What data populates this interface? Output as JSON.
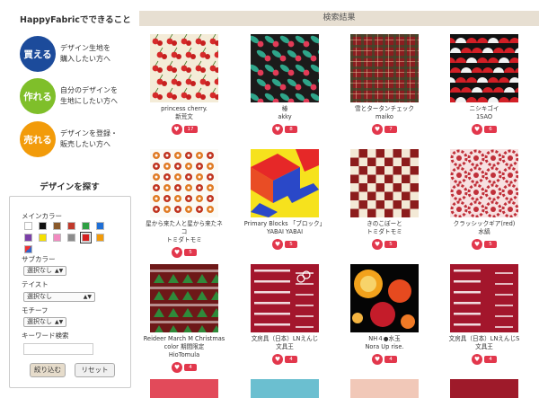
{
  "sidebar": {
    "title": "HappyFabricでできること",
    "roles": [
      {
        "label": "買える",
        "line1": "デザイン生地を",
        "line2": "購入したい方へ"
      },
      {
        "label": "作れる",
        "line1": "自分のデザインを",
        "line2": "生地にしたい方へ"
      },
      {
        "label": "売れる",
        "line1": "デザインを登録・",
        "line2": "販売したい方へ"
      }
    ],
    "find_title": "デザインを探す",
    "main_color_label": "メインカラー",
    "colors": [
      "#ffffff",
      "#111111",
      "#8a5a2b",
      "#c0392b",
      "#2ea043",
      "#1f6fd6",
      "#7b3fa8",
      "#f5e000",
      "#f28ac0",
      "#8c8c8c",
      "#d6201f",
      "#f29b0a",
      "#multi"
    ],
    "sub_color_label": "サブカラー",
    "sub_color_value": "選択なし",
    "taste_label": "テイスト",
    "taste_value": "選択なし",
    "motif_label": "モチーフ",
    "motif_value": "選択なし",
    "keyword_label": "キーワード検索",
    "keyword_value": "",
    "apply_label": "絞り込む",
    "reset_label": "リセット"
  },
  "main": {
    "header": "検索結果",
    "items": [
      {
        "name": "princess cherry.",
        "user": "新荒文",
        "likes": "17",
        "pattern": "cherry"
      },
      {
        "name": "椿",
        "user": "akky",
        "likes": "8",
        "pattern": "camellia"
      },
      {
        "name": "雪とタータンチェック",
        "user": "maiko",
        "likes": "7",
        "pattern": "tartan"
      },
      {
        "name": "ニシキゴイ",
        "user": "1SAO",
        "likes": "6",
        "pattern": "koi"
      },
      {
        "name": "星から来た人と星から来たネ",
        "name2": "コ",
        "user": "トミダトモミ",
        "likes": "5",
        "pattern": "dots"
      },
      {
        "name": "Primary Blocks 「ブロック」",
        "user": "YABAI YABAI",
        "likes": "5",
        "pattern": "blocks"
      },
      {
        "name": "きのこぼーと",
        "user": "トミダトモミ",
        "likes": "5",
        "pattern": "checker"
      },
      {
        "name": "クラッシックギア(red)",
        "user": "水縞",
        "likes": "5",
        "pattern": "gear"
      },
      {
        "name": "Reideer March M Christmas",
        "name2": "color 期間限定",
        "user": "HioTomula",
        "likes": "4",
        "pattern": "reindeer"
      },
      {
        "name": "文房具（日本）LNえんじ",
        "user": "文具王",
        "likes": "4",
        "pattern": "stationery"
      },
      {
        "name": "NH４●水玉",
        "user": "Nora Up rise.",
        "likes": "4",
        "pattern": "bubbles"
      },
      {
        "name": "文房具（日本）LNえんじS",
        "user": "文具王",
        "likes": "4",
        "pattern": "stationery2"
      }
    ]
  }
}
